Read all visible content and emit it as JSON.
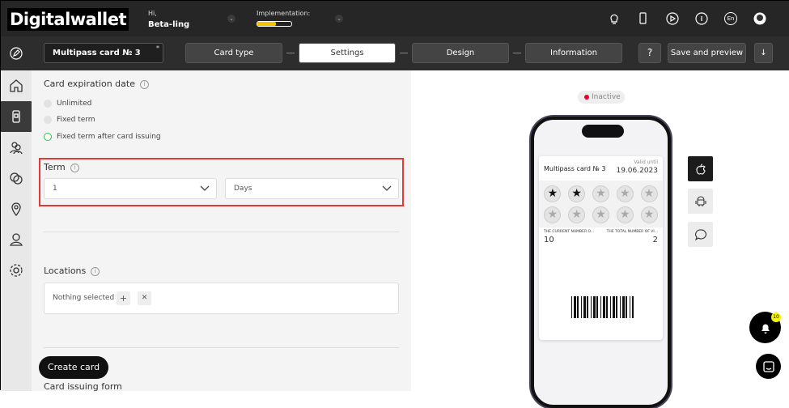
{
  "header": {
    "logo": "Digitalwallet",
    "greeting": "Hi,",
    "username": "Beta-ling",
    "implementation_label": "Implementation:",
    "implementation_progress": 0.55,
    "icons": [
      "lightbulb-icon",
      "phone-icon",
      "play-icon",
      "info-icon",
      "language-icon",
      "avatar-icon"
    ],
    "language": "En"
  },
  "stepbar": {
    "card_name": "Multipass card № 3",
    "required_mark": "*",
    "steps": [
      {
        "label": "Card type"
      },
      {
        "label": "Settings",
        "active": true
      },
      {
        "label": "Design"
      },
      {
        "label": "Information"
      }
    ],
    "help": "?",
    "save_label": "Save and preview"
  },
  "sidebar": {
    "items": [
      "home-icon",
      "card-icon",
      "users-icon",
      "chat-icon",
      "location-icon",
      "user-icon",
      "gear-icon"
    ],
    "active": 1
  },
  "form": {
    "expiration_title": "Card expiration date",
    "options": [
      {
        "label": "Unlimited"
      },
      {
        "label": "Fixed term"
      },
      {
        "label": "Fixed term after card issuing",
        "selected": true
      }
    ],
    "term_title": "Term",
    "term_value": "1",
    "term_unit": "Days",
    "locations_title": "Locations",
    "locations_value": "Nothing selected",
    "add": "+",
    "clear": "✕",
    "create_label": "Create card",
    "issuing_title": "Card issuing form"
  },
  "preview": {
    "status": "Inactive",
    "status_color": "#e8002a",
    "card_title": "Multipass card № 3",
    "valid_label": "Valid until",
    "valid_date": "19.06.2023",
    "stamps_total": 10,
    "stamps_filled": 2,
    "field1_label": "THE CURRENT NUMBER O...",
    "field1_value": "10",
    "field2_label": "THE TOTAL NUMBER OF VI...",
    "field2_value": "2",
    "platforms": [
      "apple-icon",
      "android-icon",
      "message-icon"
    ],
    "notifications": "10"
  },
  "colors": {
    "accent": "#f5c400",
    "highlight": "#e53935",
    "radio": "#2bc24a"
  }
}
